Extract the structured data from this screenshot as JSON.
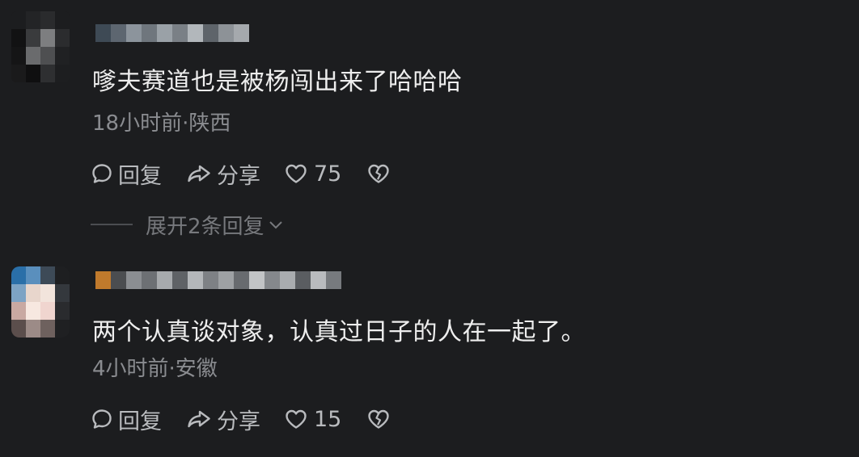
{
  "comments": [
    {
      "content": "嗲夫赛道也是被杨闯出来了哈哈哈",
      "meta": "18小时前·陕西",
      "reply_label": "回复",
      "share_label": "分享",
      "likes": "75",
      "expand_label": "展开2条回复"
    },
    {
      "content": "两个认真谈对象，认真过日子的人在一起了。",
      "meta": "4小时前·安徽",
      "reply_label": "回复",
      "share_label": "分享",
      "likes": "15"
    }
  ],
  "colors": {
    "background": "#1c1d1f",
    "text_primary": "#eeeeee",
    "text_meta": "#8a8c90",
    "action": "#b9bbbe"
  },
  "icons": [
    "comment-icon",
    "share-icon",
    "heart-icon",
    "broken-heart-icon",
    "chevron-down-icon"
  ]
}
